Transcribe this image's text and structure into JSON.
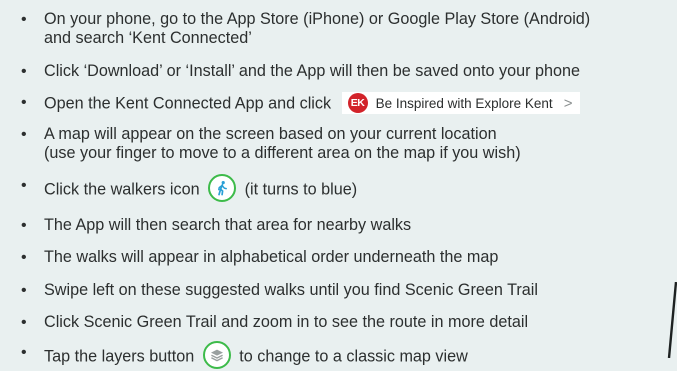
{
  "steps": [
    {
      "line1": "On your phone, go to the App Store (iPhone) or Google Play Store (Android)",
      "line2": "and search ‘Kent Connected’"
    },
    {
      "text": "Click ‘Download’ or ‘Install’ and the App will then be saved onto your phone"
    },
    {
      "text": "Open the Kent Connected App and click",
      "pill_logo": "EK",
      "pill_label": "Be Inspired with Explore Kent",
      "pill_chevron": ">"
    },
    {
      "line1": "A map will appear on the screen based on your current location",
      "line2": "(use your finger to move to a different area on the map if you wish)"
    },
    {
      "before": "Click the walkers icon",
      "icon": "walker-icon",
      "after": "(it turns to blue)"
    },
    {
      "text": "The App will then search that area for nearby walks"
    },
    {
      "text": "The walks will appear in alphabetical order underneath the map"
    },
    {
      "text": "Swipe left on these suggested walks until you find Scenic Green Trail"
    },
    {
      "text": "Click Scenic Green Trail and zoom in to see the route in more detail"
    },
    {
      "before": "Tap the layers button",
      "icon": "layers-icon",
      "after": "to change to a classic map view"
    }
  ],
  "colors": {
    "background": "#e9f0f0",
    "text": "#2c2f2f",
    "accent_green": "#3dbb4a",
    "logo_red": "#d2232a"
  }
}
